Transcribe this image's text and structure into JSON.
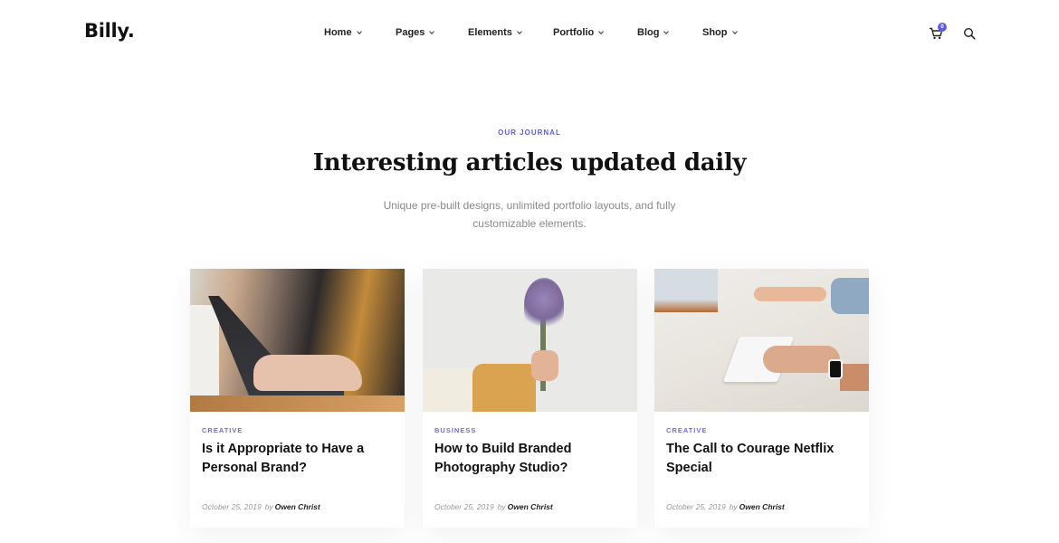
{
  "brand": {
    "logo": "Billy."
  },
  "nav": {
    "items": [
      {
        "label": "Home"
      },
      {
        "label": "Pages"
      },
      {
        "label": "Elements"
      },
      {
        "label": "Portfolio"
      },
      {
        "label": "Blog"
      },
      {
        "label": "Shop"
      }
    ]
  },
  "header_actions": {
    "cart_icon": "cart-icon",
    "cart_count": "0",
    "search_icon": "search-icon"
  },
  "section": {
    "eyebrow": "OUR JOURNAL",
    "title": "Interesting articles updated daily",
    "subtitle": "Unique pre-built designs, unlimited portfolio layouts, and fully customizable elements."
  },
  "colors": {
    "accent": "#5b5ce8",
    "text": "#111111",
    "muted": "#8a8a8a"
  },
  "posts": [
    {
      "category": "CREATIVE",
      "title": "Is it Appropriate to Have a Personal Brand?",
      "date": "October 25, 2019",
      "by": "by",
      "author": "Owen Christ",
      "image": "laptop-typing-photo"
    },
    {
      "category": "BUSINESS",
      "title": "How to Build Branded Photography Studio?",
      "date": "October 25, 2019",
      "by": "by",
      "author": "Owen Christ",
      "image": "lavender-bouquet-photo"
    },
    {
      "category": "CREATIVE",
      "title": "The Call to Courage Netflix Special",
      "date": "October 25, 2019",
      "by": "by",
      "author": "Owen Christ",
      "image": "desk-keyboard-photo"
    }
  ]
}
